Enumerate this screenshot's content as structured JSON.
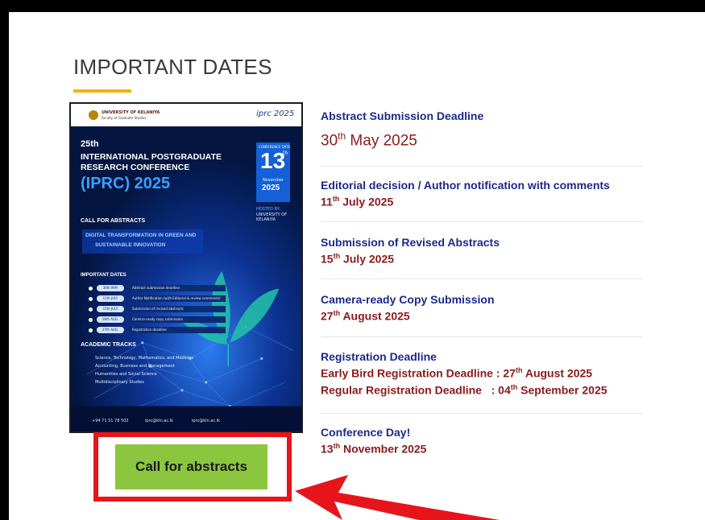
{
  "section": {
    "title": "IMPORTANT DATES"
  },
  "poster": {
    "university": "UNIVERSITY OF KELANIYA",
    "faculty": "Faculty of Graduate Studies",
    "logo": "iprc 2025",
    "edition": "25th",
    "line1": "INTERNATIONAL POSTGRADUATE",
    "line2": "RESEARCH CONFERENCE",
    "line3": "(IPRC) 2025",
    "conference_date_label": "CONFERENCE DATE",
    "day": "13",
    "day_suffix": "th",
    "month": "November",
    "year": "2025",
    "hosted_by": "HOSTED BY:",
    "host": "UNIVERSITY OF KELANIYA",
    "cfa": "CALL FOR ABSTRACTS",
    "theme1": "DIGITAL TRANSFORMATION IN GREEN AND",
    "theme2": "SUSTAINABLE INNOVATION",
    "important_dates": "IMPORTANT DATES",
    "dates": [
      {
        "d": "30th MAY",
        "t": "Abstract submission deadline"
      },
      {
        "d": "11th JULY",
        "t": "Author Notification (with Editorial & review comments)"
      },
      {
        "d": "15th JULY",
        "t": "Submission of revised abstracts"
      },
      {
        "d": "18th AUG.",
        "t": "Camera-ready copy submission"
      },
      {
        "d": "27th AUG.",
        "t": "Registration deadline"
      }
    ],
    "tracks_title": "ACADEMIC TRACKS",
    "tracks": [
      "Science, Technology, Mathematics, and Medicine",
      "Accounting, Business and Management",
      "Humanities and Social Science",
      "Multidisciplinary Studies"
    ],
    "contact_phone": "+94 71 51 78 502",
    "contact_email": "iprc@kln.ac.lk",
    "contact_web": "iprc@kln.ac.lk"
  },
  "dates": [
    {
      "title": "Abstract Submission Deadline",
      "day": "30",
      "sup": "th",
      "rest": " May 2025"
    },
    {
      "title": "Editorial decision / Author notification with comments",
      "day": "11",
      "sup": "th",
      "rest": " July 2025"
    },
    {
      "title": "Submission of Revised Abstracts",
      "day": "15",
      "sup": "th",
      "rest": " July 2025"
    },
    {
      "title": "Camera-ready Copy Submission",
      "day": "27",
      "sup": "th",
      "rest": " August 2025"
    },
    {
      "title": "Registration Deadline",
      "early_label": "Early Bird Registration Deadline : ",
      "early_day": "27",
      "early_sup": "th",
      "early_rest": " August 2025",
      "regular_label": "Regular Registration Deadline   : ",
      "regular_day": "04",
      "regular_sup": "th",
      "regular_rest": " September 2025"
    },
    {
      "title": "Conference Day!",
      "day": "13",
      "sup": "th",
      "rest": " November 2025"
    }
  ],
  "button": {
    "label": "Call for abstracts"
  },
  "colors": {
    "accent": "#f0b400",
    "button": "#8cc63f",
    "highlight": "#e8141b",
    "heading": "#1a2a8a",
    "date": "#8a1b1b"
  },
  "icons": {
    "arrow": "arrow-pointer-icon"
  }
}
